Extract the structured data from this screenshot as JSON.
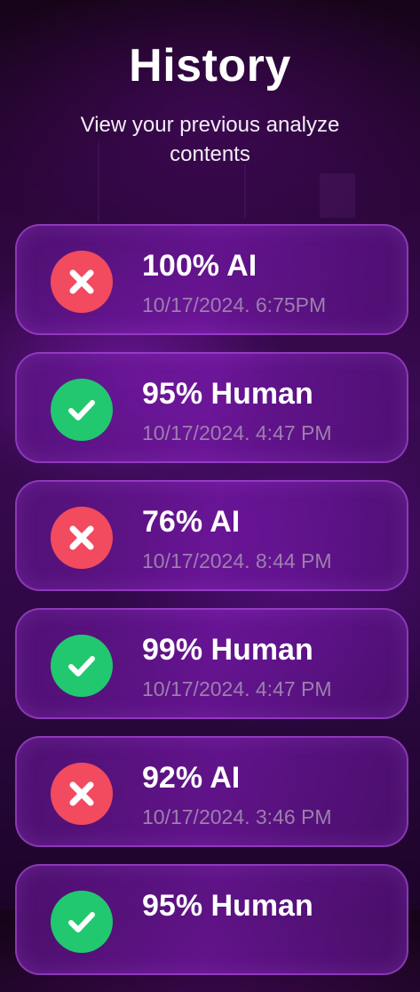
{
  "header": {
    "title": "History",
    "subtitle": "View your previous analyze contents"
  },
  "colors": {
    "ai_icon": "#f24a5e",
    "human_icon": "#21c86f",
    "timestamp_text": "#9d7fae",
    "card_border": "#be5af0"
  },
  "history": [
    {
      "result": "100% AI",
      "timestamp": "10/17/2024. 6:75PM",
      "type": "ai",
      "icon": "x-icon"
    },
    {
      "result": "95% Human",
      "timestamp": "10/17/2024. 4:47 PM",
      "type": "human",
      "icon": "check-icon"
    },
    {
      "result": "76% AI",
      "timestamp": "10/17/2024. 8:44 PM",
      "type": "ai",
      "icon": "x-icon"
    },
    {
      "result": "99% Human",
      "timestamp": "10/17/2024. 4:47 PM",
      "type": "human",
      "icon": "check-icon"
    },
    {
      "result": "92% AI",
      "timestamp": "10/17/2024. 3:46 PM",
      "type": "ai",
      "icon": "x-icon"
    },
    {
      "result": "95% Human",
      "timestamp": "",
      "type": "human",
      "icon": "check-icon"
    }
  ]
}
